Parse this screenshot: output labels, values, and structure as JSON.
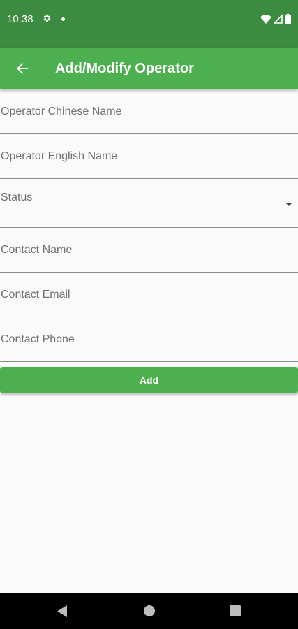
{
  "status_bar": {
    "time": "10:38",
    "icons": [
      "gear-icon",
      "notification-dot-icon",
      "wifi-icon",
      "signal-icon",
      "battery-icon"
    ]
  },
  "app_bar": {
    "title": "Add/Modify Operator",
    "back_icon": "arrow-left-icon",
    "color": "#4caf50",
    "status_color": "#3d8b40"
  },
  "form": {
    "operator_chinese_name": {
      "placeholder": "Operator Chinese Name",
      "value": ""
    },
    "operator_english_name": {
      "placeholder": "Operator English Name",
      "value": ""
    },
    "status": {
      "label": "Status",
      "value": ""
    },
    "contact_name": {
      "placeholder": "Contact Name",
      "value": ""
    },
    "contact_email": {
      "placeholder": "Contact Email",
      "value": ""
    },
    "contact_phone": {
      "placeholder": "Contact Phone",
      "value": ""
    }
  },
  "add_button": {
    "label": "Add"
  },
  "nav_bar": {
    "icons": [
      "nav-back-icon",
      "nav-home-icon",
      "nav-recents-icon"
    ]
  }
}
